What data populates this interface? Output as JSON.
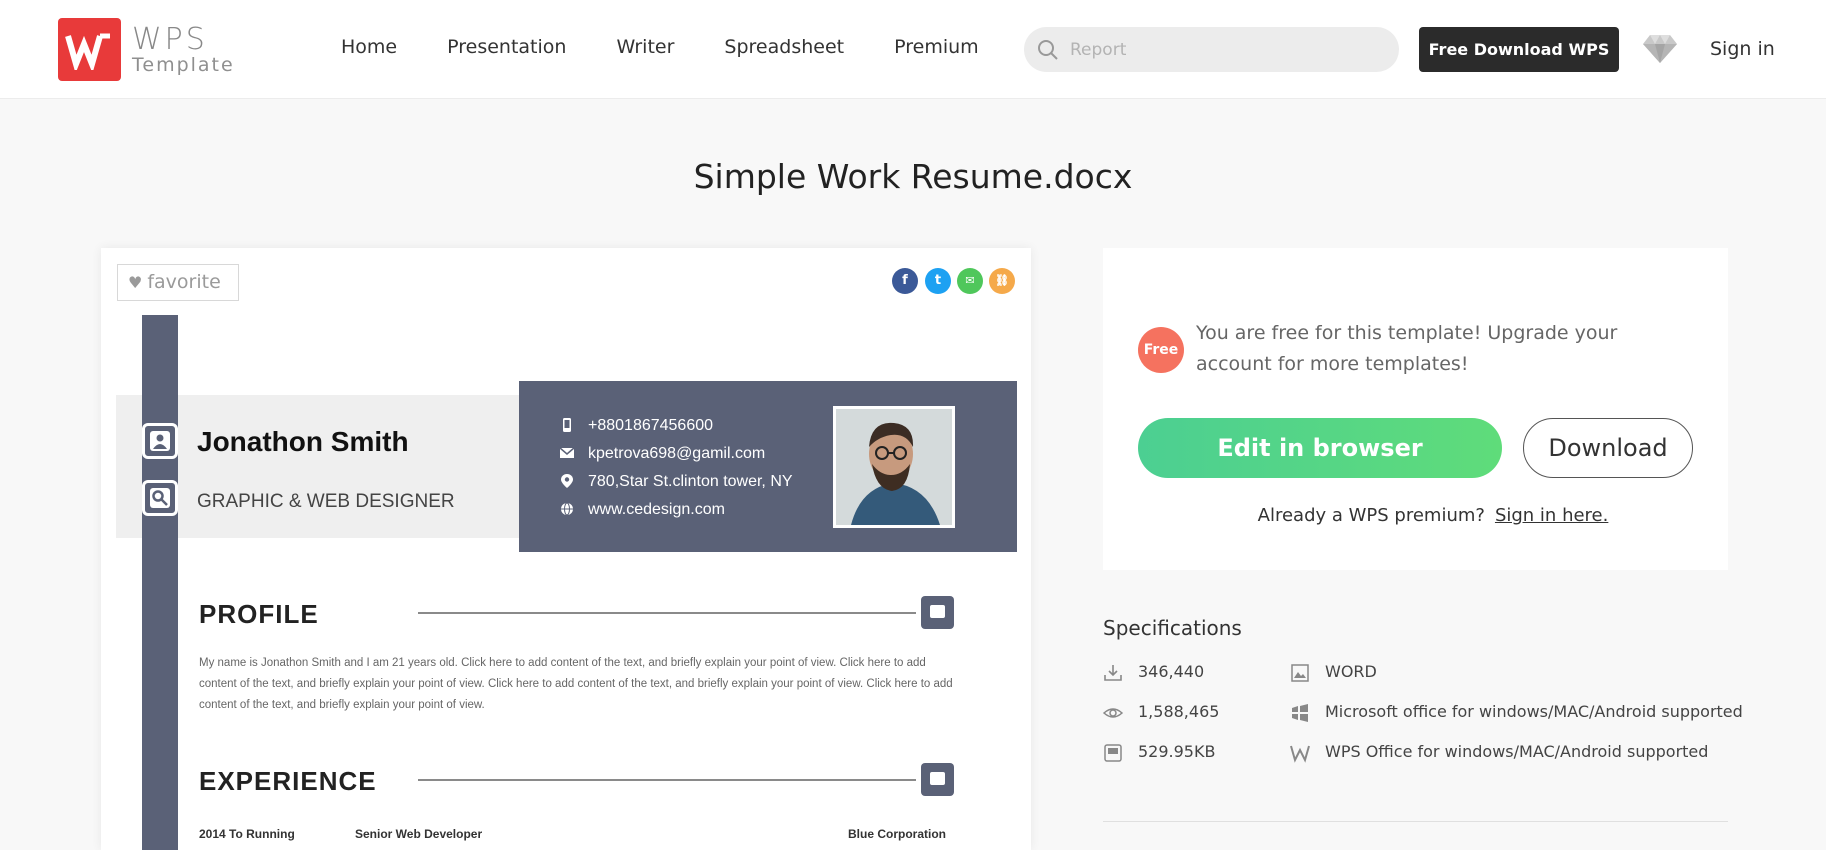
{
  "header": {
    "logo_wps": "WPS",
    "logo_template": "Template",
    "nav": [
      "Home",
      "Presentation",
      "Writer",
      "Spreadsheet",
      "Premium"
    ],
    "search_placeholder": "Report",
    "download_button": "Free Download WPS",
    "sign_in": "Sign in"
  },
  "page_title": "Simple Work Resume.docx",
  "preview": {
    "favorite": "favorite",
    "share": [
      "f",
      "t",
      "✉",
      "⛓"
    ],
    "resume": {
      "name": "Jonathon Smith",
      "role": "GRAPHIC & WEB DESIGNER",
      "contacts": [
        "+8801867456600",
        "kpetrova698@gamil.com",
        "780,Star St.clinton tower, NY",
        "www.cedesign.com"
      ],
      "profile_heading": "PROFILE",
      "profile_text": "My name is Jonathon Smith and I am 21 years old. Click here to add content of the text, and briefly explain your point of view. Click here to add content of the text, and briefly explain your point of view. Click here to add content of the text, and briefly explain your point of view. Click here to add content of the text, and briefly explain your point of view.",
      "experience_heading": "EXPERIENCE",
      "experience": {
        "period": "2014 To Running",
        "title": "Senior Web Developer",
        "company": "Blue Corporation"
      }
    }
  },
  "panel": {
    "free_badge": "Free",
    "free_text": "You are free for this template! Upgrade your account for more templates!",
    "edit_button": "Edit in browser",
    "download_button": "Download",
    "premium_question": "Already a WPS premium?",
    "premium_link": "Sign in here."
  },
  "specifications": {
    "title": "Specifications",
    "downloads": "346,440",
    "views": "1,588,465",
    "size": "529.95KB",
    "format": "WORD",
    "ms_support": "Microsoft office for windows/MAC/Android supported",
    "wps_support": "WPS Office for windows/MAC/Android supported"
  },
  "colors": {
    "brand_red": "#e83a3a",
    "edit_green": "#4ccf92",
    "resume_slate": "#5a6177",
    "free_badge": "#f5725f"
  }
}
